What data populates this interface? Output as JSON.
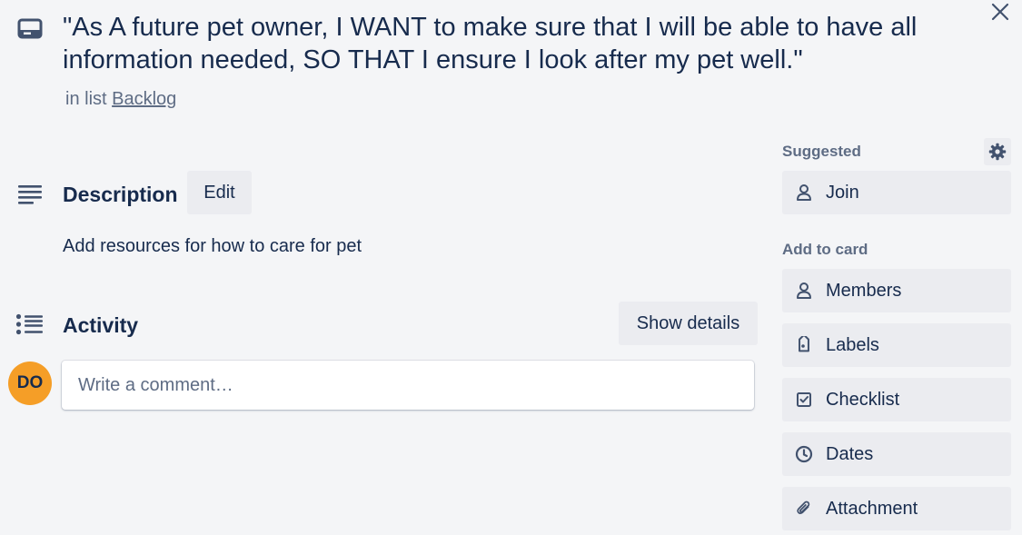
{
  "card": {
    "title": "\"As A future pet owner, I WANT to make sure that I will be able to have all information needed, SO THAT I ensure I look after my pet well.\"",
    "list_prefix": "in list ",
    "list_name": "Backlog"
  },
  "description": {
    "title": "Description",
    "edit_label": "Edit",
    "text": "Add resources for how to care for pet"
  },
  "activity": {
    "title": "Activity",
    "show_details_label": "Show details",
    "avatar_initials": "DO",
    "comment_placeholder": "Write a comment…"
  },
  "sidebar": {
    "suggested_label": "Suggested",
    "join_label": "Join",
    "add_to_card_label": "Add to card",
    "items": [
      {
        "label": "Members",
        "icon": "person-icon"
      },
      {
        "label": "Labels",
        "icon": "tag-icon"
      },
      {
        "label": "Checklist",
        "icon": "checkbox-icon"
      },
      {
        "label": "Dates",
        "icon": "clock-icon"
      },
      {
        "label": "Attachment",
        "icon": "paperclip-icon"
      }
    ]
  },
  "colors": {
    "background": "#f4f5f7",
    "button": "#ebecf0",
    "text": "#172b4d",
    "muted": "#5e6c84",
    "avatar": "#f59e27"
  }
}
